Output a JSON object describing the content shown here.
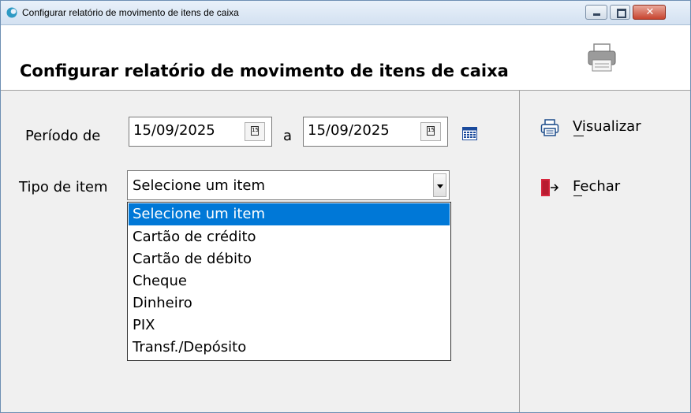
{
  "window": {
    "title": "Configurar relatório de movimento de itens de caixa",
    "close_symbol": "✕"
  },
  "header": {
    "title": "Configurar relatório de movimento de itens de caixa",
    "icon": "printer-icon"
  },
  "form": {
    "periodo_label": "Período de",
    "date_from": "15/09/2025",
    "a_label": "a",
    "date_to": "15/09/2025",
    "calendar_glyph": "15",
    "tipo_label": "Tipo de item",
    "tipo_selected": "Selecione um item",
    "options": [
      "Selecione um item",
      "Cartão de crédito",
      "Cartão de débito",
      "Cheque",
      "Dinheiro",
      "PIX",
      "Transf./Depósito"
    ]
  },
  "actions": {
    "visualizar": "Visualizar",
    "fechar": "Fechar"
  },
  "colors": {
    "selection": "#0078d7",
    "close_button": "#c7442f",
    "exit_red": "#d7263d"
  }
}
